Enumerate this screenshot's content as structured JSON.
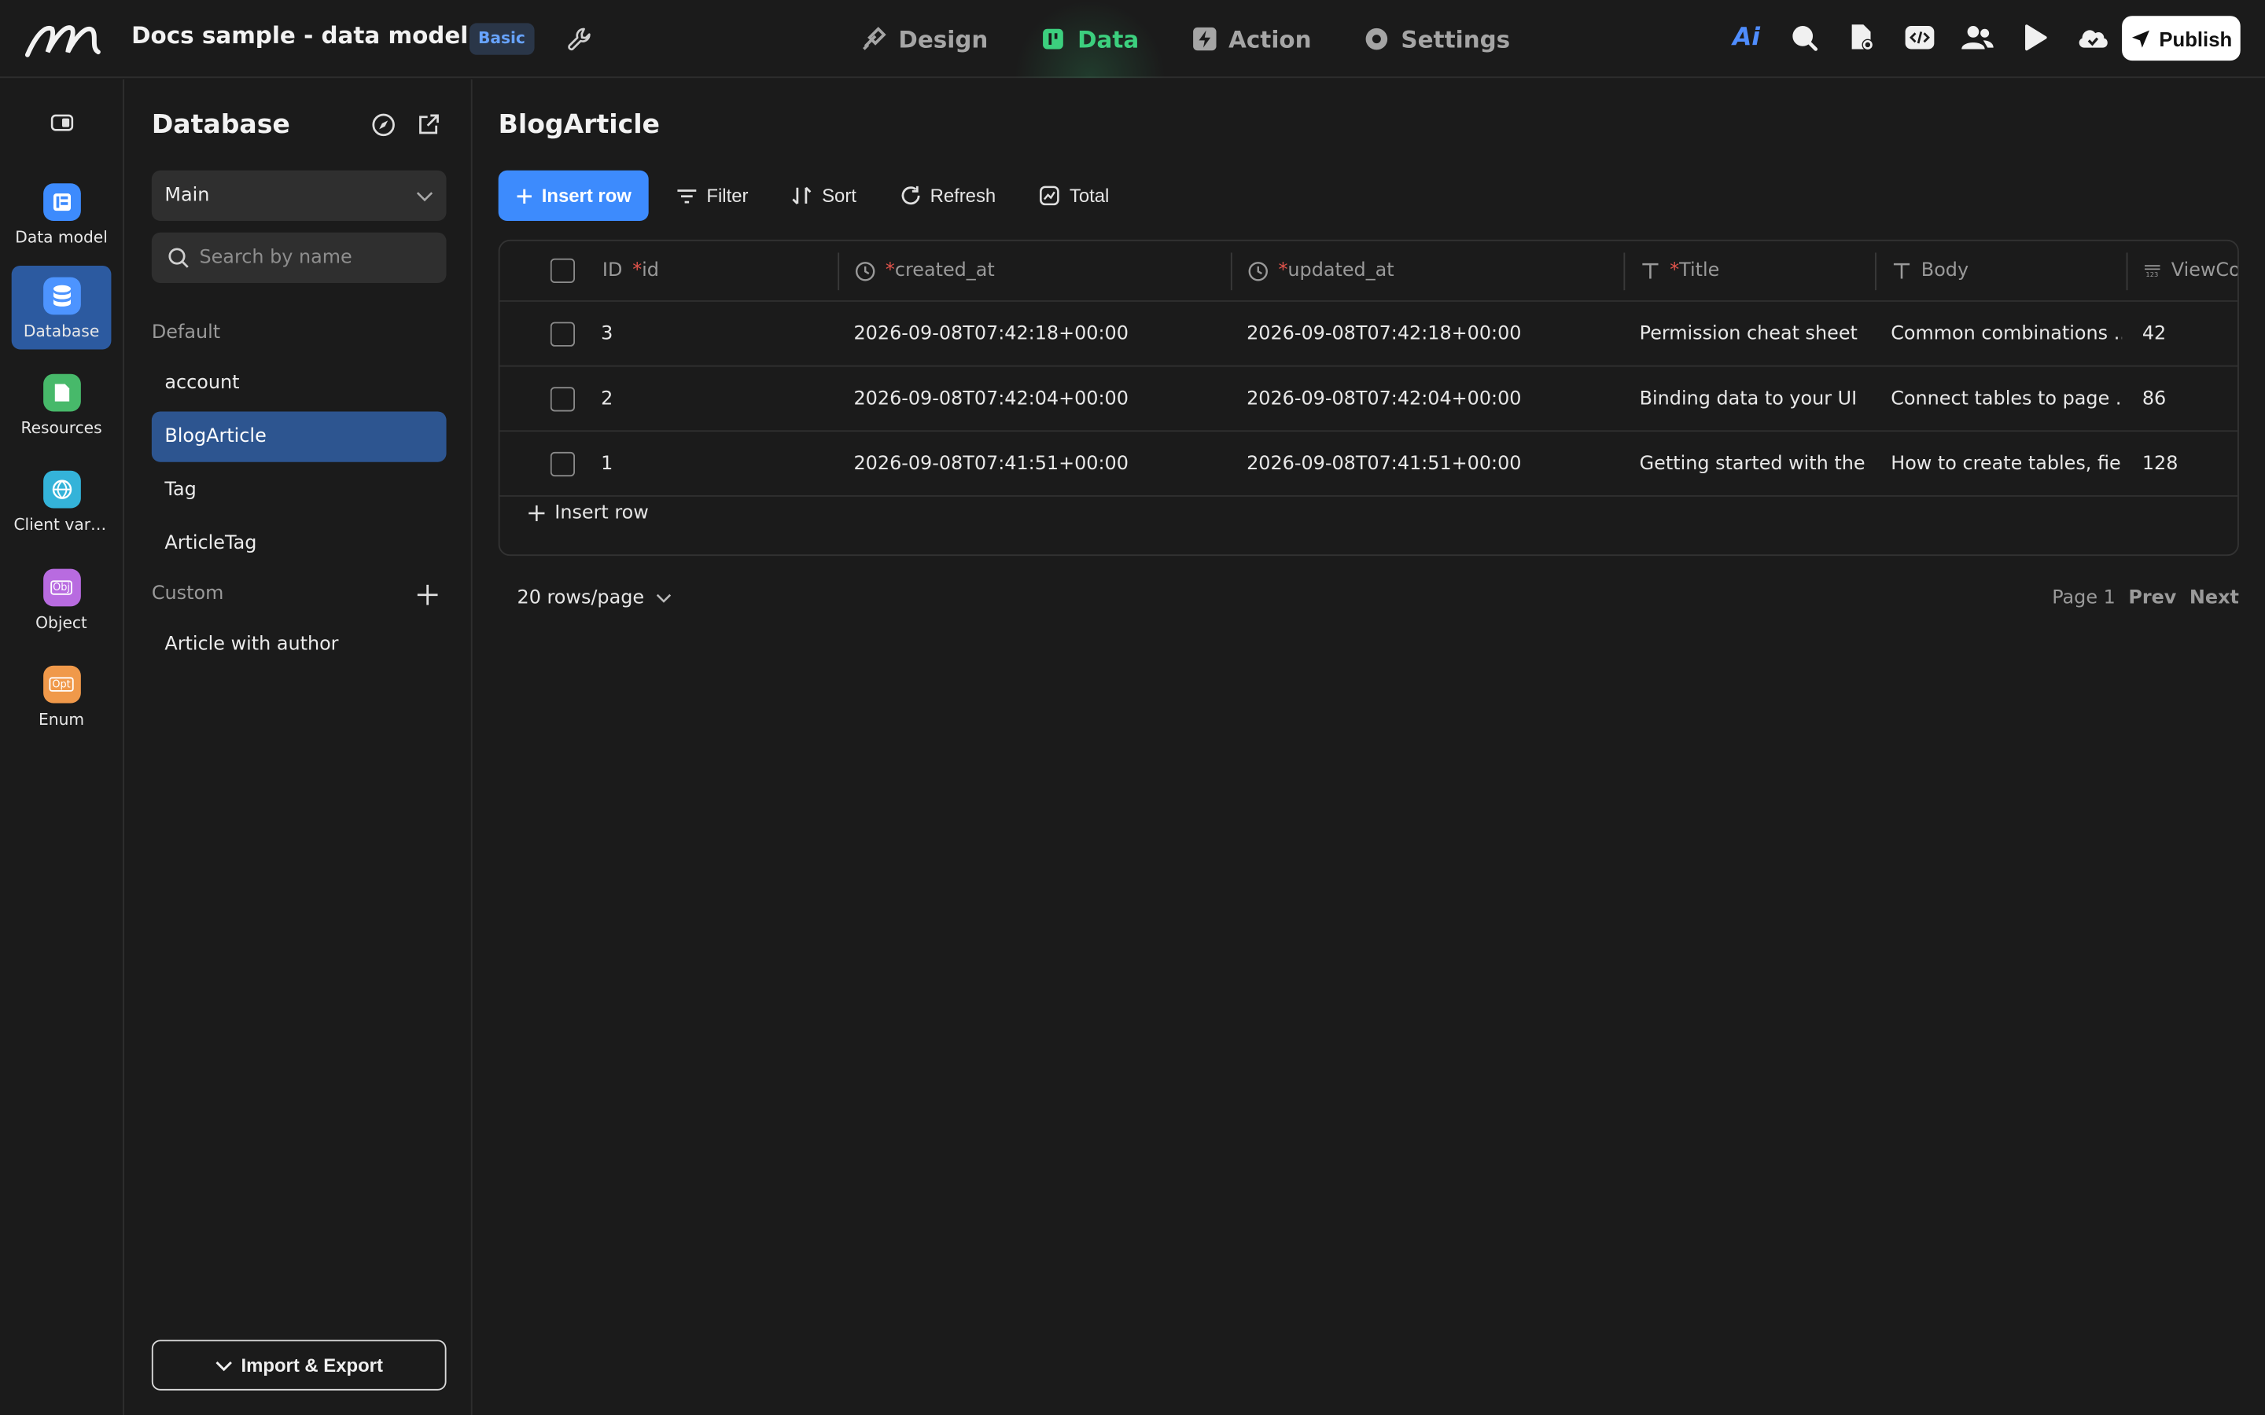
{
  "header": {
    "app_title": "Docs sample - data model",
    "plan_badge": "Basic",
    "tabs": [
      {
        "label": "Design",
        "icon": "brush-icon"
      },
      {
        "label": "Data",
        "icon": "data-icon"
      },
      {
        "label": "Action",
        "icon": "bolt-icon"
      },
      {
        "label": "Settings",
        "icon": "gear-icon"
      }
    ],
    "ai_label": "Ai",
    "publish_label": "Publish",
    "accent_color": "#3ccf7e",
    "primary_color": "#3d8bfd"
  },
  "rail": {
    "items": [
      {
        "label": "Data model",
        "icon": "data-model-icon"
      },
      {
        "label": "Database",
        "icon": "database-icon"
      },
      {
        "label": "Resources",
        "icon": "resources-icon"
      },
      {
        "label": "Client vari...",
        "icon": "globe-icon"
      },
      {
        "label": "Object",
        "icon": "object-icon",
        "glyph": "Obj"
      },
      {
        "label": "Enum",
        "icon": "enum-icon",
        "glyph": "Opt"
      }
    ]
  },
  "db_panel": {
    "title": "Database",
    "db_select": "Main",
    "search_placeholder": "Search by name",
    "default_group_label": "Default",
    "default_tables": [
      "account",
      "BlogArticle",
      "Tag",
      "ArticleTag"
    ],
    "custom_group_label": "Custom",
    "custom_tables": [
      "Article with author"
    ],
    "import_export_label": "Import & Export"
  },
  "main": {
    "title": "BlogArticle",
    "toolbar": {
      "insert_row": "Insert row",
      "filter": "Filter",
      "sort": "Sort",
      "refresh": "Refresh",
      "total": "Total"
    },
    "columns": [
      {
        "prefix": "ID",
        "req": "*",
        "name": "id"
      },
      {
        "req": "*",
        "name": "created_at"
      },
      {
        "req": "*",
        "name": "updated_at"
      },
      {
        "req": "*",
        "name": "Title"
      },
      {
        "req": "",
        "name": "Body"
      },
      {
        "req": "",
        "name": "ViewCo"
      }
    ],
    "rows": [
      {
        "id": "3",
        "created_at": "2026-09-08T07:42:18+00:00",
        "updated_at": "2026-09-08T07:42:18+00:00",
        "title": "Permission cheat sheet",
        "body": "Common combinations ...",
        "views": "42"
      },
      {
        "id": "2",
        "created_at": "2026-09-08T07:42:04+00:00",
        "updated_at": "2026-09-08T07:42:04+00:00",
        "title": "Binding data to your UI",
        "body": "Connect tables to page ...",
        "views": "86"
      },
      {
        "id": "1",
        "created_at": "2026-09-08T07:41:51+00:00",
        "updated_at": "2026-09-08T07:41:51+00:00",
        "title": "Getting started with the ...",
        "body": "How to create tables, fiel...",
        "views": "128"
      }
    ],
    "insert_row_link": "Insert row",
    "rows_per_page": "20 rows/page",
    "page_label": "Page 1",
    "prev": "Prev",
    "next": "Next"
  }
}
